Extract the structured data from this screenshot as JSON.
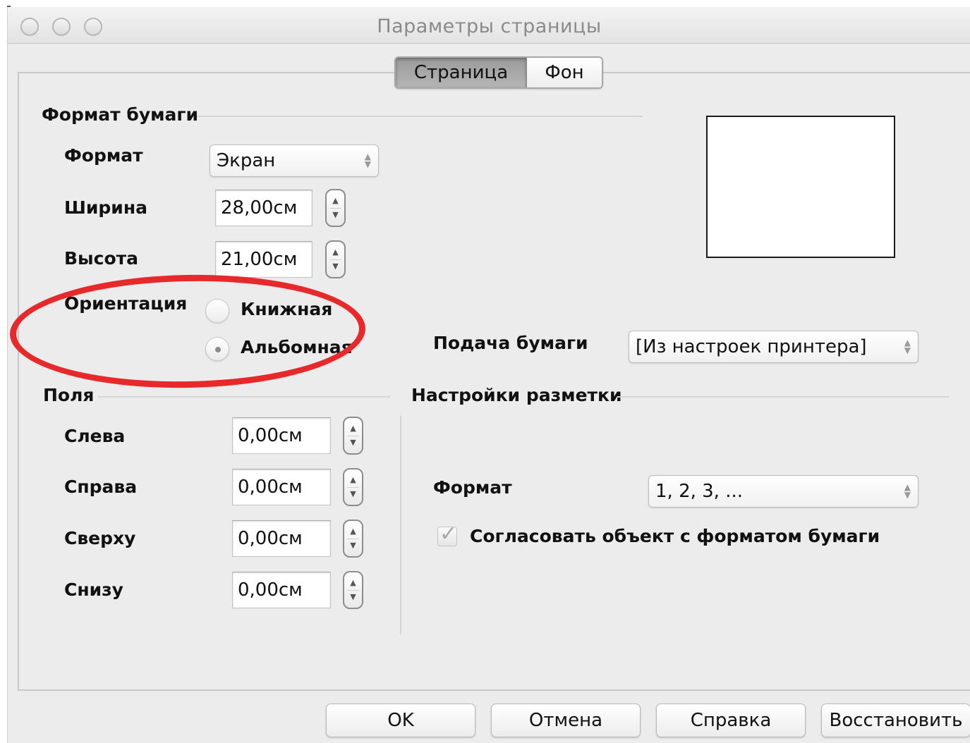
{
  "window": {
    "title": "Параметры страницы"
  },
  "tabs": [
    {
      "label": "Страница",
      "active": true
    },
    {
      "label": "Фон",
      "active": false
    }
  ],
  "paper_format": {
    "section_title": "Формат бумаги",
    "format_label": "Формат",
    "format_value": "Экран",
    "width_label": "Ширина",
    "width_value": "28,00см",
    "height_label": "Высота",
    "height_value": "21,00см",
    "orientation_label": "Ориентация",
    "orientation_portrait": "Книжная",
    "orientation_landscape": "Альбомная",
    "orientation_selected": "landscape",
    "tray_label": "Подача бумаги",
    "tray_value": "[Из настроек принтера]"
  },
  "margins": {
    "section_title": "Поля",
    "left_label": "Слева",
    "left_value": "0,00см",
    "right_label": "Справа",
    "right_value": "0,00см",
    "top_label": "Сверху",
    "top_value": "0,00см",
    "bottom_label": "Снизу",
    "bottom_value": "0,00см"
  },
  "layout": {
    "section_title": "Настройки разметки",
    "format_label": "Формат",
    "format_value": "1, 2, 3, ...",
    "fit_label": "Согласовать объект с форматом бумаги",
    "fit_checked": true
  },
  "buttons": {
    "ok": "OK",
    "cancel": "Отмена",
    "help": "Справка",
    "reset": "Восстановить"
  },
  "annotation": {
    "color": "#e8292b",
    "shape": "ellipse"
  },
  "icons": {
    "stepper": "up-down-stepper-icon",
    "select_arrows": "up-down-chevron-icon",
    "checkmark": "checkmark-icon"
  }
}
